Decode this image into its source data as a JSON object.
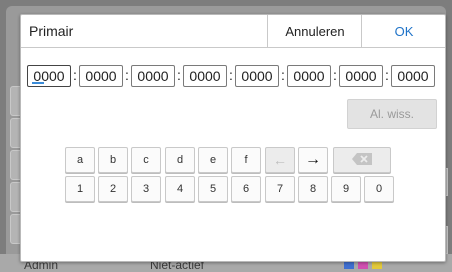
{
  "dialog": {
    "title": "Primair",
    "cancel_label": "Annuleren",
    "ok_label": "OK",
    "colors": {
      "ok": "#1f73c8",
      "caret": "#3a8bd8"
    }
  },
  "address": {
    "separator": ":",
    "segments": [
      "0000",
      "0000",
      "0000",
      "0000",
      "0000",
      "0000",
      "0000",
      "0000"
    ],
    "active_index": 0
  },
  "al_wiss": {
    "label": "Al. wiss.",
    "enabled": false
  },
  "keyboard": {
    "row1": [
      "a",
      "b",
      "c",
      "d",
      "e",
      "f"
    ],
    "row2": [
      "1",
      "2",
      "3",
      "4",
      "5",
      "6",
      "7",
      "8",
      "9",
      "0"
    ],
    "left_arrow": "←",
    "right_arrow": "→",
    "backspace_icon": "backspace-icon"
  },
  "background": {
    "bottom_left": "Admin",
    "bottom_middle": "Niet-actief"
  }
}
